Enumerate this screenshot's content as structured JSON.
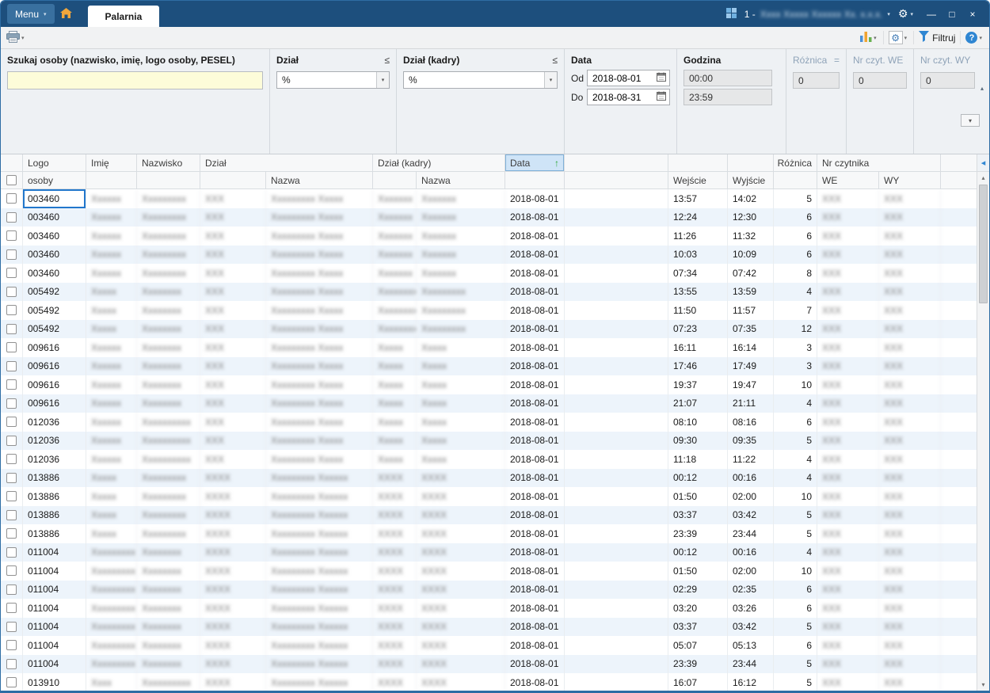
{
  "titlebar": {
    "menu_label": "Menu",
    "tab_label": "Palarnia",
    "workspace_prefix": "1 -",
    "company_name_redacted": "Xxxx Xxxxx Xxxxxx Xx. x.x.x.",
    "window_buttons": {
      "minimize": "—",
      "maximize": "□",
      "close": "×"
    }
  },
  "toolbar": {
    "filter_button_label": "Filtruj"
  },
  "icons": {
    "dropdown_glyph": "▾",
    "gear_glyph": "⚙",
    "help_glyph": "?",
    "collapse_up_glyph": "▴",
    "collapse_left_glyph": "◂",
    "scroll_up_glyph": "▴",
    "scroll_down_glyph": "▾"
  },
  "filter_panel": {
    "search": {
      "label": "Szukaj osoby (nazwisko, imię, logo osoby, PESEL)",
      "value": ""
    },
    "dzial": {
      "label": "Dział",
      "operator": "≤",
      "value": "%"
    },
    "dzial_kadry": {
      "label": "Dział (kadry)",
      "operator": "≤",
      "value": "%"
    },
    "data": {
      "label": "Data",
      "od_label": "Od",
      "od_value": "2018-08-01",
      "do_label": "Do",
      "do_value": "2018-08-31"
    },
    "godzina": {
      "label": "Godzina",
      "od_value": "00:00",
      "do_value": "23:59"
    },
    "roznica": {
      "label": "Różnica",
      "operator": "=",
      "value": "0"
    },
    "nr_czyt_we": {
      "label": "Nr czyt. WE",
      "operator": "=",
      "value": "0"
    },
    "nr_czyt_wy": {
      "label": "Nr czyt. WY",
      "operator": "=",
      "value": "0"
    }
  },
  "table": {
    "headers": {
      "logo_line1": "Logo",
      "logo_line2": "osoby",
      "imie": "Imię",
      "nazwisko": "Nazwisko",
      "dzial": "Dział",
      "dzial_nazwa": "Nazwa",
      "dzial_kadry": "Dział (kadry)",
      "dzial_kadry_nazwa": "Nazwa",
      "data": "Data",
      "wejscie": "Wejście",
      "wyjscie": "Wyjście",
      "roznica": "Różnica",
      "nr_czytnika": "Nr czytnika",
      "we": "WE",
      "wy": "WY"
    },
    "sort": {
      "column": "Data",
      "direction": "asc",
      "glyph": "↑"
    },
    "focused_cell": {
      "row": 0,
      "column": "logo"
    },
    "persons": {
      "003460": {
        "imie": "Xxxxxx",
        "nazwisko": "Xxxxxxxxx",
        "dzial": "XXX",
        "dzial_nazwa": "Xxxxxxxxx Xxxxx",
        "dzial_kadry": "Xxxxxxx",
        "dzial_kadry_nazwa": "Xxxxxxx",
        "czyt_we": "XXX",
        "czyt_wy": "XXX"
      },
      "005492": {
        "imie": "Xxxxx",
        "nazwisko": "Xxxxxxxx",
        "dzial": "XXX",
        "dzial_nazwa": "Xxxxxxxxx Xxxxx",
        "dzial_kadry": "Xxxxxxxxx",
        "dzial_kadry_nazwa": "Xxxxxxxxx",
        "czyt_we": "XXX",
        "czyt_wy": "XXX"
      },
      "009616": {
        "imie": "Xxxxxx",
        "nazwisko": "Xxxxxxxx",
        "dzial": "XXX",
        "dzial_nazwa": "Xxxxxxxxx Xxxxx",
        "dzial_kadry": "Xxxxx",
        "dzial_kadry_nazwa": "Xxxxx",
        "czyt_we": "XXX",
        "czyt_wy": "XXX"
      },
      "012036": {
        "imie": "Xxxxxx",
        "nazwisko": "Xxxxxxxxxx",
        "dzial": "XXX",
        "dzial_nazwa": "Xxxxxxxxx Xxxxx",
        "dzial_kadry": "Xxxxx",
        "dzial_kadry_nazwa": "Xxxxx",
        "czyt_we": "XXX",
        "czyt_wy": "XXX"
      },
      "013886": {
        "imie": "Xxxxx",
        "nazwisko": "Xxxxxxxxx",
        "dzial": "XXXX",
        "dzial_nazwa": "Xxxxxxxxx Xxxxxx",
        "dzial_kadry": "XXXX",
        "dzial_kadry_nazwa": "XXXX",
        "czyt_we": "XXX",
        "czyt_wy": "XXX"
      },
      "011004": {
        "imie": "Xxxxxxxxx",
        "nazwisko": "Xxxxxxxx",
        "dzial": "XXXX",
        "dzial_nazwa": "Xxxxxxxxx Xxxxxx",
        "dzial_kadry": "XXXX",
        "dzial_kadry_nazwa": "XXXX",
        "czyt_we": "XXX",
        "czyt_wy": "XXX"
      },
      "013910": {
        "imie": "Xxxx",
        "nazwisko": "Xxxxxxxxxx",
        "dzial": "XXXX",
        "dzial_nazwa": "Xxxxxxxxx Xxxxxx",
        "dzial_kadry": "XXXX",
        "dzial_kadry_nazwa": "XXXX",
        "czyt_we": "XXX",
        "czyt_wy": "XXX"
      }
    },
    "rows": [
      {
        "logo": "003460",
        "data": "2018-08-01",
        "wejscie": "13:57",
        "wyjscie": "14:02",
        "roznica": "5"
      },
      {
        "logo": "003460",
        "data": "2018-08-01",
        "wejscie": "12:24",
        "wyjscie": "12:30",
        "roznica": "6"
      },
      {
        "logo": "003460",
        "data": "2018-08-01",
        "wejscie": "11:26",
        "wyjscie": "11:32",
        "roznica": "6"
      },
      {
        "logo": "003460",
        "data": "2018-08-01",
        "wejscie": "10:03",
        "wyjscie": "10:09",
        "roznica": "6"
      },
      {
        "logo": "003460",
        "data": "2018-08-01",
        "wejscie": "07:34",
        "wyjscie": "07:42",
        "roznica": "8"
      },
      {
        "logo": "005492",
        "data": "2018-08-01",
        "wejscie": "13:55",
        "wyjscie": "13:59",
        "roznica": "4"
      },
      {
        "logo": "005492",
        "data": "2018-08-01",
        "wejscie": "11:50",
        "wyjscie": "11:57",
        "roznica": "7"
      },
      {
        "logo": "005492",
        "data": "2018-08-01",
        "wejscie": "07:23",
        "wyjscie": "07:35",
        "roznica": "12"
      },
      {
        "logo": "009616",
        "data": "2018-08-01",
        "wejscie": "16:11",
        "wyjscie": "16:14",
        "roznica": "3"
      },
      {
        "logo": "009616",
        "data": "2018-08-01",
        "wejscie": "17:46",
        "wyjscie": "17:49",
        "roznica": "3"
      },
      {
        "logo": "009616",
        "data": "2018-08-01",
        "wejscie": "19:37",
        "wyjscie": "19:47",
        "roznica": "10"
      },
      {
        "logo": "009616",
        "data": "2018-08-01",
        "wejscie": "21:07",
        "wyjscie": "21:11",
        "roznica": "4"
      },
      {
        "logo": "012036",
        "data": "2018-08-01",
        "wejscie": "08:10",
        "wyjscie": "08:16",
        "roznica": "6"
      },
      {
        "logo": "012036",
        "data": "2018-08-01",
        "wejscie": "09:30",
        "wyjscie": "09:35",
        "roznica": "5"
      },
      {
        "logo": "012036",
        "data": "2018-08-01",
        "wejscie": "11:18",
        "wyjscie": "11:22",
        "roznica": "4"
      },
      {
        "logo": "013886",
        "data": "2018-08-01",
        "wejscie": "00:12",
        "wyjscie": "00:16",
        "roznica": "4"
      },
      {
        "logo": "013886",
        "data": "2018-08-01",
        "wejscie": "01:50",
        "wyjscie": "02:00",
        "roznica": "10"
      },
      {
        "logo": "013886",
        "data": "2018-08-01",
        "wejscie": "03:37",
        "wyjscie": "03:42",
        "roznica": "5"
      },
      {
        "logo": "013886",
        "data": "2018-08-01",
        "wejscie": "23:39",
        "wyjscie": "23:44",
        "roznica": "5"
      },
      {
        "logo": "011004",
        "data": "2018-08-01",
        "wejscie": "00:12",
        "wyjscie": "00:16",
        "roznica": "4"
      },
      {
        "logo": "011004",
        "data": "2018-08-01",
        "wejscie": "01:50",
        "wyjscie": "02:00",
        "roznica": "10"
      },
      {
        "logo": "011004",
        "data": "2018-08-01",
        "wejscie": "02:29",
        "wyjscie": "02:35",
        "roznica": "6"
      },
      {
        "logo": "011004",
        "data": "2018-08-01",
        "wejscie": "03:20",
        "wyjscie": "03:26",
        "roznica": "6"
      },
      {
        "logo": "011004",
        "data": "2018-08-01",
        "wejscie": "03:37",
        "wyjscie": "03:42",
        "roznica": "5"
      },
      {
        "logo": "011004",
        "data": "2018-08-01",
        "wejscie": "05:07",
        "wyjscie": "05:13",
        "roznica": "6"
      },
      {
        "logo": "011004",
        "data": "2018-08-01",
        "wejscie": "23:39",
        "wyjscie": "23:44",
        "roznica": "5"
      },
      {
        "logo": "013910",
        "data": "2018-08-01",
        "wejscie": "16:07",
        "wyjscie": "16:12",
        "roznica": "5"
      }
    ]
  },
  "colors": {
    "titlebar_blue": "#1d4f7d",
    "sort_arrow_green": "#2ea836",
    "search_bg_yellow": "#fdfcd9",
    "alt_row_blue": "#edf4fb",
    "focus_border_blue": "#2277cc"
  }
}
